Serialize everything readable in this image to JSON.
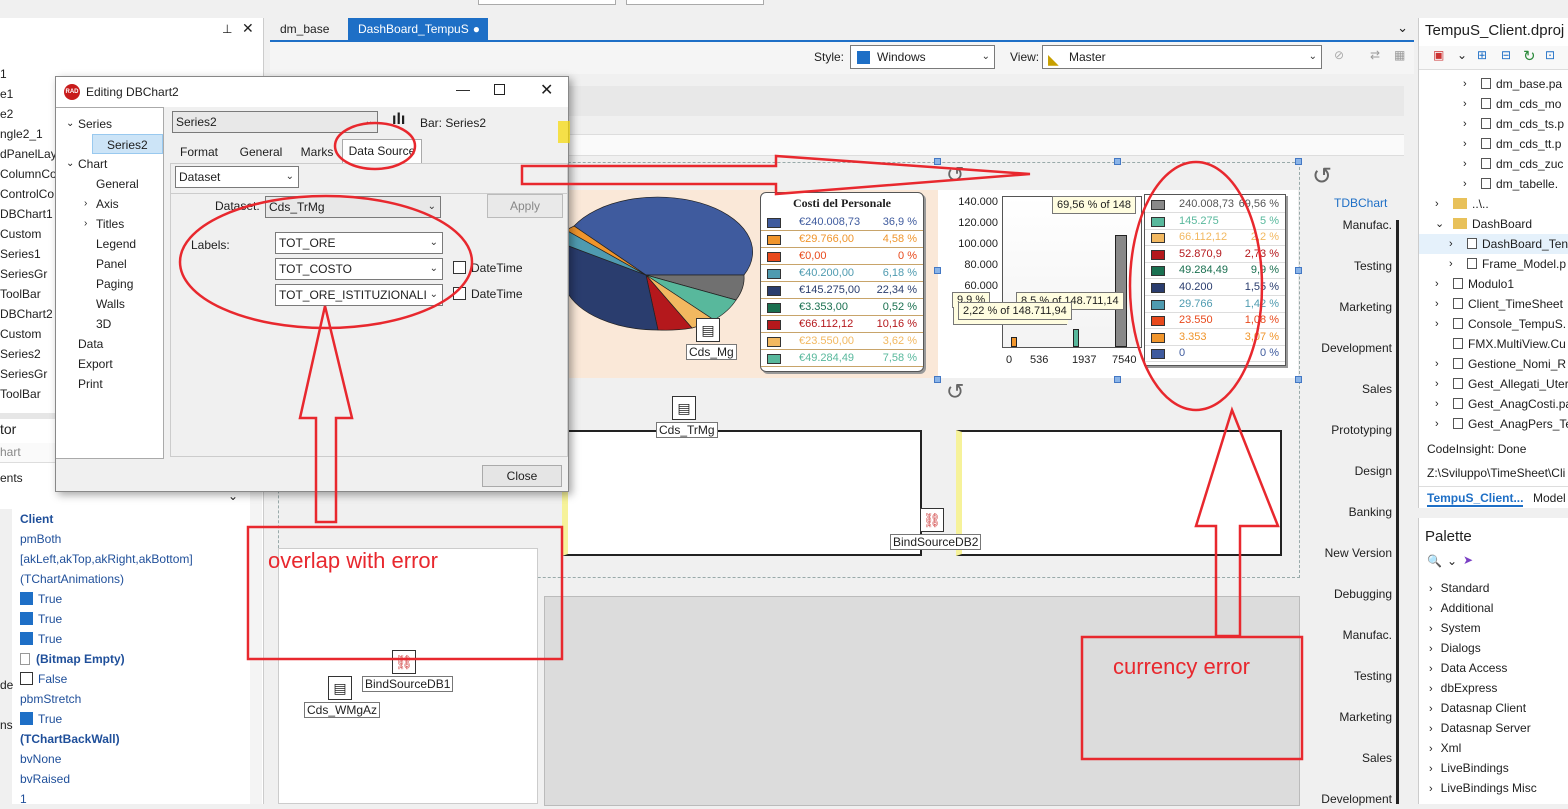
{
  "colors": {
    "accent": "#1e6fc6",
    "annotation": "#e8282e"
  },
  "editor_tabs": [
    "dm_base",
    "DashBoard_TempuS"
  ],
  "toolbar": {
    "style_label": "Style:",
    "style_value": "Windows",
    "view_label": "View:",
    "view_value": "Master"
  },
  "left_tree": [
    "1",
    "e1",
    "e2",
    "ngle2_1",
    "dPanelLayo",
    "ColumnCo",
    "ControlCo",
    "DBChart1",
    "Custom",
    "Series1",
    "SeriesGr",
    "ToolBar",
    "DBChart2",
    "Custom",
    "Series2",
    "SeriesGr",
    "ToolBar"
  ],
  "inspector": {
    "title": "tor",
    "filter": "hart",
    "section": "ents",
    "values": [
      "Client",
      "pmBoth",
      "[akLeft,akTop,akRight,akBottom]",
      "(TChartAnimations)",
      "True",
      "True",
      "True",
      "(Bitmap Empty)",
      "False",
      "pbmStretch",
      "True",
      "(TChartBackWall)",
      "bvNone",
      "bvRaised",
      "1"
    ],
    "stub_labels": [
      "de",
      "ns"
    ]
  },
  "dialog": {
    "title": "Editing DBChart2",
    "tree": [
      {
        "label": "Series",
        "exp": "⌄"
      },
      {
        "label": "Series2",
        "sel": true
      },
      {
        "label": "Chart",
        "exp": "⌄"
      },
      {
        "label": "General"
      },
      {
        "label": "Axis",
        "exp": "›"
      },
      {
        "label": "Titles",
        "exp": "›"
      },
      {
        "label": "Legend"
      },
      {
        "label": "Panel"
      },
      {
        "label": "Paging"
      },
      {
        "label": "Walls"
      },
      {
        "label": "3D"
      },
      {
        "label": "Data"
      },
      {
        "label": "Export"
      },
      {
        "label": "Print"
      }
    ],
    "series_select": "Series2",
    "series_type": "Bar: Series2",
    "tabs": [
      "Format",
      "General",
      "Marks",
      "Data Source"
    ],
    "source_select": "Dataset",
    "dataset_label": "Dataset:",
    "dataset_value": "Cds_TrMg",
    "apply": "Apply",
    "labels_label": "Labels:",
    "field1": "TOT_ORE",
    "field2": "TOT_COSTO",
    "field3": "TOT_ORE_ISTITUZIONALI",
    "datetime": "DateTime",
    "close": "Close"
  },
  "pie_legend": {
    "title": "Costi del Personale",
    "rows": [
      {
        "v": "€240.008,73",
        "p": "36,9 %",
        "c": "#3f5b9e"
      },
      {
        "v": "€29.766,00",
        "p": "4,58 %",
        "c": "#f0952c"
      },
      {
        "v": "€0,00",
        "p": "0 %",
        "c": "#e8491c"
      },
      {
        "v": "€40.200,00",
        "p": "6,18 %",
        "c": "#4f9bb0"
      },
      {
        "v": "€145.275,00",
        "p": "22,34 %",
        "c": "#2a3d6e"
      },
      {
        "v": "€3.353,00",
        "p": "0,52 %",
        "c": "#1a7050"
      },
      {
        "v": "€66.112,12",
        "p": "10,16 %",
        "c": "#b4181c"
      },
      {
        "v": "€23.550,00",
        "p": "3,62 %",
        "c": "#f2b860"
      },
      {
        "v": "€49.284,49",
        "p": "7,58 %",
        "c": "#58b89c"
      }
    ]
  },
  "bar_legend": {
    "rows": [
      {
        "v": "240.008,73",
        "p": "69,56 %",
        "c": "#888888"
      },
      {
        "v": "145.275",
        "p": "5 %",
        "c": "#58b89c"
      },
      {
        "v": "66.112,12",
        "p": "2,2 %",
        "c": "#f2b860"
      },
      {
        "v": "52.870,9",
        "p": "2,73 %",
        "c": "#b4181c"
      },
      {
        "v": "49.284,49",
        "p": "9,9 %",
        "c": "#1a7050"
      },
      {
        "v": "40.200",
        "p": "1,55 %",
        "c": "#2a3d6e"
      },
      {
        "v": "29.766",
        "p": "1,42 %",
        "c": "#4f9bb0"
      },
      {
        "v": "23.550",
        "p": "1,08 %",
        "c": "#e8491c"
      },
      {
        "v": "3.353",
        "p": "3,07 %",
        "c": "#f0952c"
      },
      {
        "v": "0",
        "p": "0 %",
        "c": "#3f5b9e"
      }
    ]
  },
  "bar_axis": {
    "y": [
      "140.000",
      "120.000",
      "100.000",
      "80.000",
      "60.000"
    ],
    "x": [
      "0",
      "536",
      "1937",
      "7540"
    ]
  },
  "tooltips": [
    "69,56 % of 148",
    "8,5 % of 148.711,14",
    "2,22 % of 148.711,94",
    "9,9 %"
  ],
  "components": [
    "Cds_Mg",
    "Cds_TrMg",
    "BindSourceDB2",
    "BindSourceDB1",
    "Cds_WMgAz"
  ],
  "tdbchart": {
    "title": "TDBChart",
    "labels": [
      "Manufac.",
      "Testing",
      "Marketing",
      "Development",
      "Sales",
      "Prototyping",
      "Design",
      "Banking",
      "New Version",
      "Debugging",
      "Manufac.",
      "Testing",
      "Marketing",
      "Sales",
      "Development"
    ]
  },
  "project": {
    "title": "TempuS_Client.dproj",
    "files": [
      "dm_base.pa",
      "dm_cds_mo",
      "dm_cds_ts.p",
      "dm_cds_tt.p",
      "dm_cds_zuc",
      "dm_tabelle.",
      "..\\..",
      "DashBoard",
      "DashBoard_Ten",
      "Frame_Model.p",
      "Modulo1",
      "Client_TimeSheet",
      "Console_TempuS.",
      "FMX.MultiView.Cu",
      "Gestione_Nomi_R",
      "Gest_Allegati_Uter",
      "Gest_AnagCosti.pa",
      "Gest_AnagPers_Te"
    ],
    "status": "CodeInsight: Done",
    "path": "Z:\\Sviluppo\\TimeSheet\\Cli",
    "tab1": "TempuS_Client...",
    "tab2": "Model"
  },
  "palette": {
    "title": "Palette",
    "items": [
      "Standard",
      "Additional",
      "System",
      "Dialogs",
      "Data Access",
      "dbExpress",
      "Datasnap Client",
      "Datasnap Server",
      "Xml",
      "LiveBindings",
      "LiveBindings Misc"
    ]
  },
  "annotations": {
    "overlap": "overlap with error",
    "currency": "currency error"
  }
}
